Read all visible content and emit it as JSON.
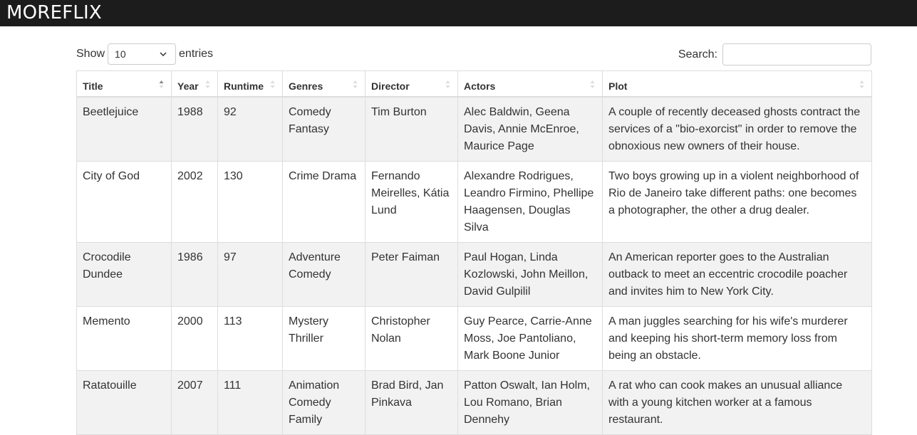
{
  "brand": "MOREFLIX",
  "length": {
    "show_label": "Show",
    "value": "10",
    "entries_label": "entries"
  },
  "search": {
    "label": "Search:",
    "value": "",
    "placeholder": ""
  },
  "table": {
    "columns": [
      "Title",
      "Year",
      "Runtime",
      "Genres",
      "Director",
      "Actors",
      "Plot"
    ],
    "sorted_column": "Title",
    "sort_direction": "ascending",
    "rows": [
      [
        "Beetlejuice",
        "1988",
        "92",
        "Comedy Fantasy",
        "Tim Burton",
        "Alec Baldwin, Geena Davis, Annie McEnroe, Maurice Page",
        "A couple of recently deceased ghosts contract the services of a \"bio-exorcist\" in order to remove the obnoxious new owners of their house."
      ],
      [
        "City of God",
        "2002",
        "130",
        "Crime Drama",
        "Fernando Meirelles, Kátia Lund",
        "Alexandre Rodrigues, Leandro Firmino, Phellipe Haagensen, Douglas Silva",
        "Two boys growing up in a violent neighborhood of Rio de Janeiro take different paths: one becomes a photographer, the other a drug dealer."
      ],
      [
        "Crocodile Dundee",
        "1986",
        "97",
        "Adventure Comedy",
        "Peter Faiman",
        "Paul Hogan, Linda Kozlowski, John Meillon, David Gulpilil",
        "An American reporter goes to the Australian outback to meet an eccentric crocodile poacher and invites him to New York City."
      ],
      [
        "Memento",
        "2000",
        "113",
        "Mystery Thriller",
        "Christopher Nolan",
        "Guy Pearce, Carrie-Anne Moss, Joe Pantoliano, Mark Boone Junior",
        "A man juggles searching for his wife's murderer and keeping his short-term memory loss from being an obstacle."
      ],
      [
        "Ratatouille",
        "2007",
        "111",
        "Animation Comedy Family",
        "Brad Bird, Jan Pinkava",
        "Patton Oswalt, Ian Holm, Lou Romano, Brian Dennehy",
        "A rat who can cook makes an unusual alliance with a young kitchen worker at a famous restaurant."
      ]
    ]
  }
}
